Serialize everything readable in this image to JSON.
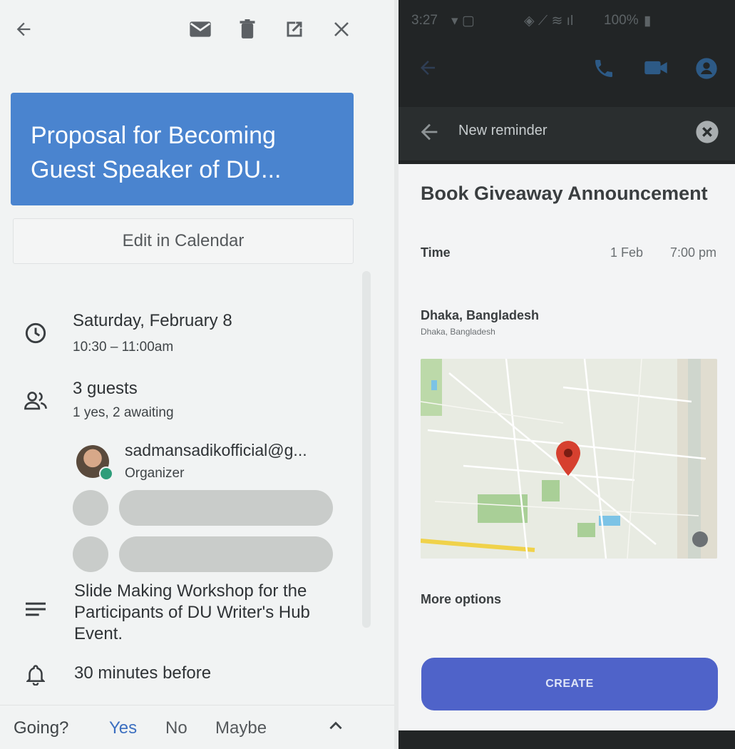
{
  "event": {
    "title": "Proposal for Becoming Guest Speaker of DU...",
    "edit_label": "Edit in Calendar",
    "date": "Saturday, February 8",
    "time": "10:30 – 11:00am",
    "guests_title": "3 guests",
    "guests_summary": "1 yes, 2 awaiting",
    "organizer_email": "sadmansadikofficial@g...",
    "organizer_role": "Organizer",
    "description": "Slide Making Workshop for the Participants of DU Writer's Hub Event.",
    "reminder": "30 minutes before"
  },
  "rsvp": {
    "prompt": "Going?",
    "yes": "Yes",
    "no": "No",
    "maybe": "Maybe"
  },
  "icons": {
    "back": "arrow-left-icon",
    "mail": "mail-icon",
    "delete": "trash-icon",
    "open": "open-external-icon",
    "close": "close-icon",
    "clock": "clock-icon",
    "guests": "people-icon",
    "description": "notes-icon",
    "bell": "bell-icon",
    "expand": "chevron-up-icon"
  },
  "phone": {
    "status_time": "3:27",
    "battery": "100%",
    "header_label": "New reminder",
    "reminder_title": "Book Giveaway Announcement",
    "time_label": "Time",
    "time_date": "1 Feb",
    "time_value": "7:00 pm",
    "location_name": "Dhaka, Bangladesh",
    "location_sub": "Dhaka, Bangladesh",
    "more_options": "More options",
    "create_label": "CREATE"
  },
  "colors": {
    "event_header": "#4a84cf",
    "rsvp_selected": "#3c6fc0",
    "create_button": "#4f63c9",
    "map_pin": "#d6402f"
  }
}
